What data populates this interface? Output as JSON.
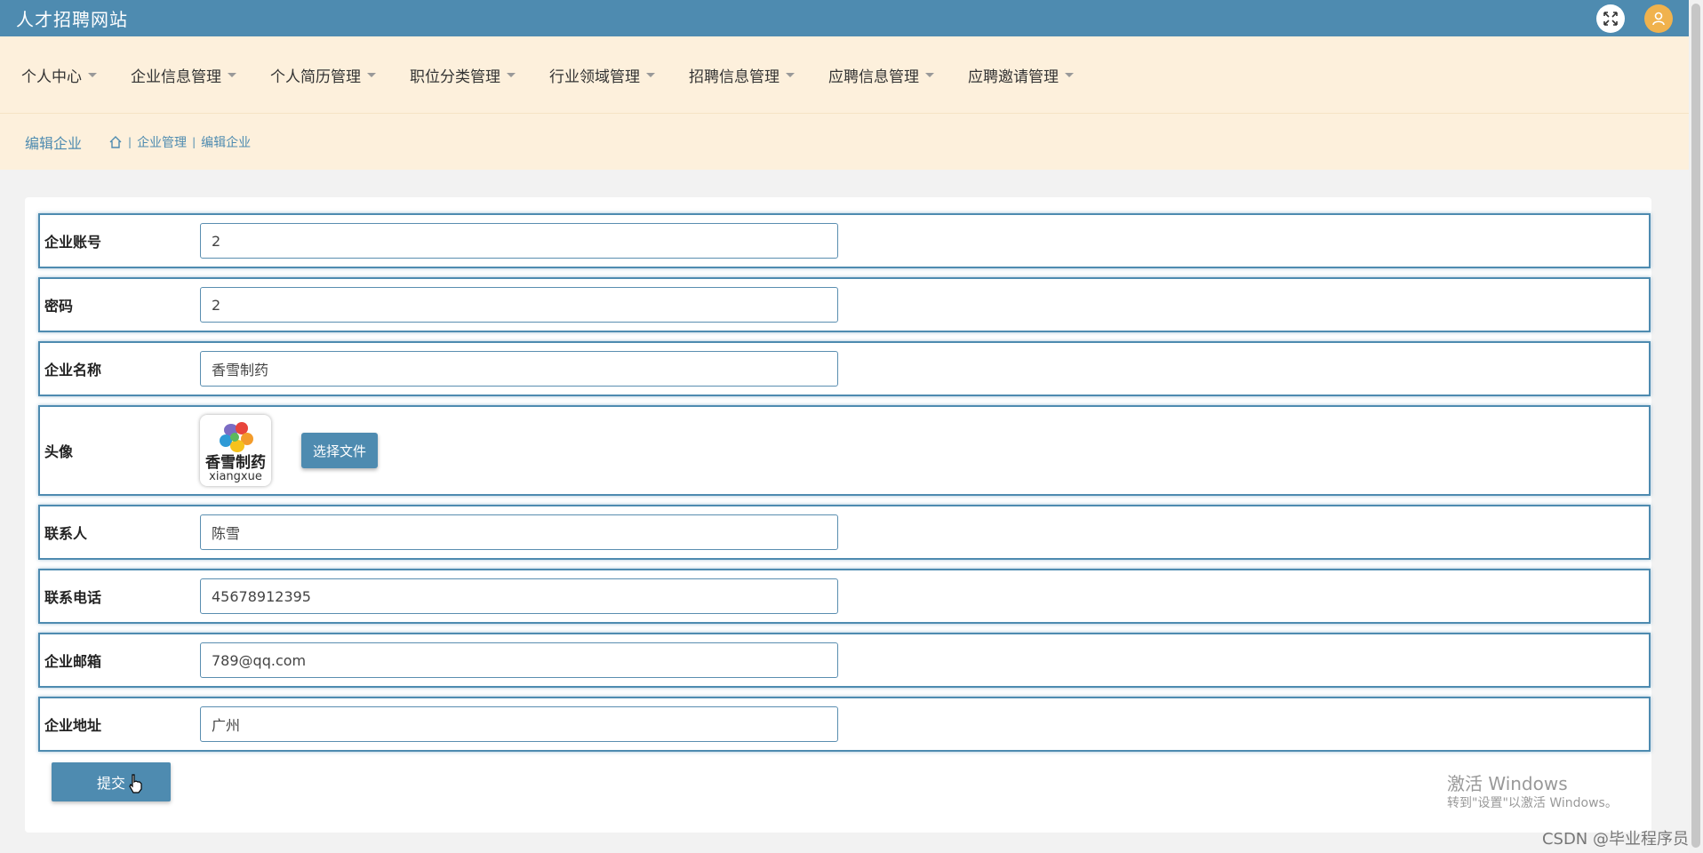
{
  "app": {
    "title": "人才招聘网站"
  },
  "topbar": {
    "fullscreen_icon": "expand-icon",
    "user_icon": "user-icon"
  },
  "nav": {
    "items": [
      {
        "label": "个人中心"
      },
      {
        "label": "企业信息管理"
      },
      {
        "label": "个人简历管理"
      },
      {
        "label": "职位分类管理"
      },
      {
        "label": "行业领域管理"
      },
      {
        "label": "招聘信息管理"
      },
      {
        "label": "应聘信息管理"
      },
      {
        "label": "应聘邀请管理"
      }
    ]
  },
  "breadcrumb": {
    "title": "编辑企业",
    "home_icon": "home-icon",
    "items": [
      "企业管理",
      "编辑企业"
    ],
    "separator": "|"
  },
  "form": {
    "fields": [
      {
        "label": "企业账号",
        "value": "2"
      },
      {
        "label": "密码",
        "value": "2"
      },
      {
        "label": "企业名称",
        "value": "香雪制药"
      },
      {
        "label": "联系人",
        "value": "陈雪"
      },
      {
        "label": "联系电话",
        "value": "45678912395"
      },
      {
        "label": "企业邮箱",
        "value": "789@qq.com"
      },
      {
        "label": "企业地址",
        "value": "广州"
      }
    ],
    "avatar": {
      "label": "头像",
      "logo_cn": "香雪制药",
      "logo_en": "xiangxue",
      "choose_file_label": "选择文件"
    },
    "submit_label": "提交"
  },
  "watermark": {
    "title": "激活 Windows",
    "subtitle": "转到\"设置\"以激活 Windows。"
  },
  "credit": "CSDN @毕业程序员",
  "colors": {
    "primary": "#4e8bb0",
    "nav_bg": "#fdf0dc",
    "accent_orange": "#f0b24d"
  }
}
